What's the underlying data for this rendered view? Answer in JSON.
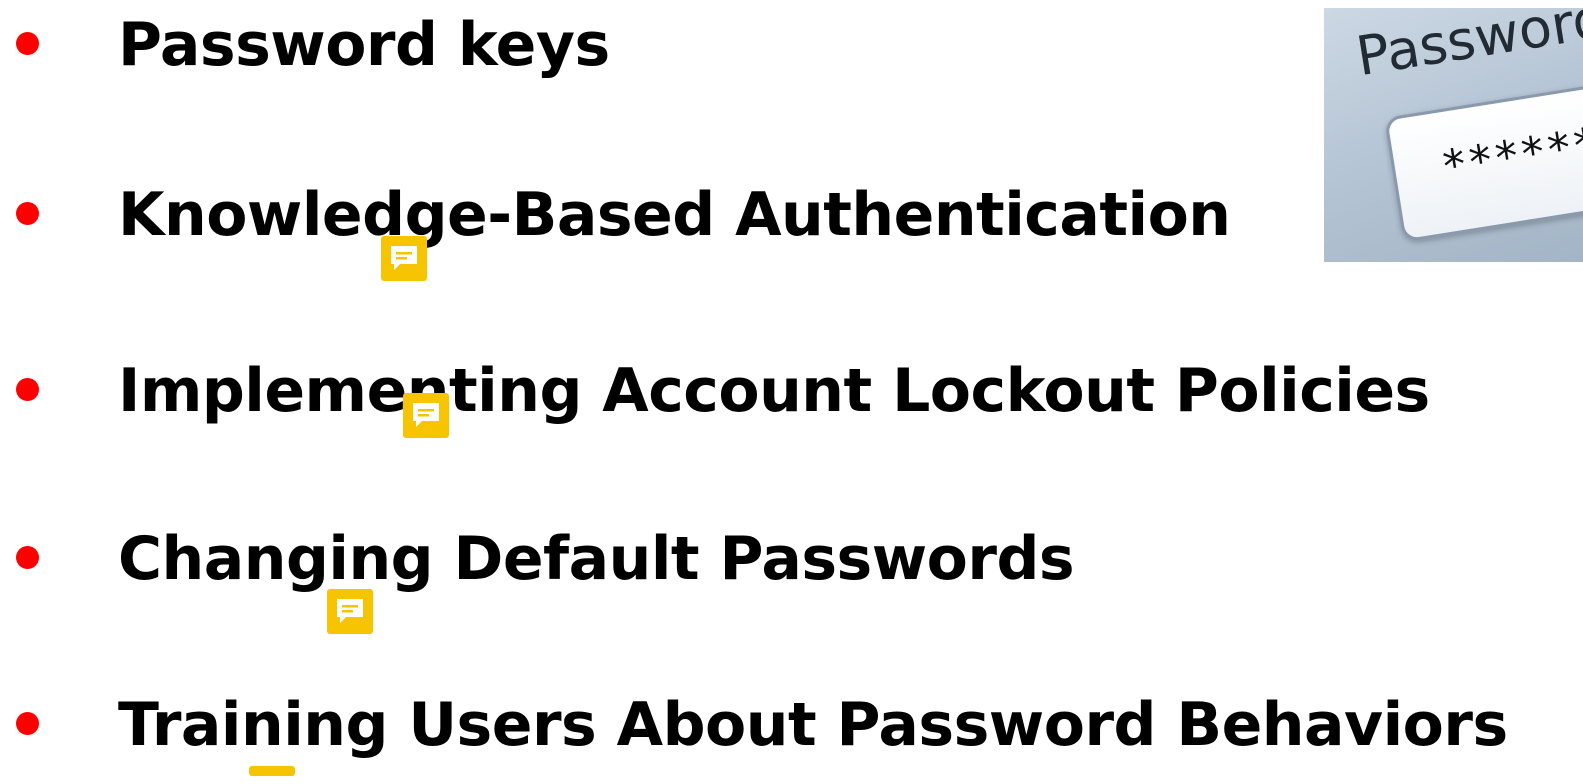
{
  "slide": {
    "bullets": [
      "Password keys",
      "Knowledge-Based Authentication",
      "Implementing Account Lockout Policies",
      "Changing Default Passwords",
      "Training Users About Password Behaviors"
    ],
    "image": {
      "heading": "Password",
      "masked_value": "*******"
    }
  },
  "colors": {
    "bullet": "#ff0000",
    "comment_marker": "#f6c400",
    "text": "#000000"
  },
  "icons": {
    "comment_marker": "comment-icon"
  }
}
